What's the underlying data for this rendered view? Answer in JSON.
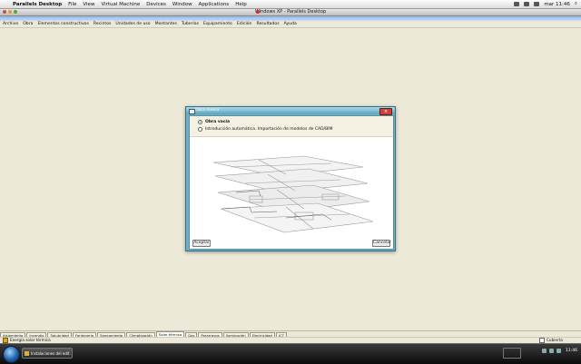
{
  "mac_menu": {
    "app_name": "Parallels Desktop",
    "items": [
      "File",
      "View",
      "Virtual Machine",
      "Devices",
      "Window",
      "Applications",
      "Help"
    ],
    "clock": "mar 11:46"
  },
  "vm_window": {
    "title": "Windows XP - Parallels Desktop"
  },
  "app_menu": {
    "items": [
      "Archivo",
      "Obra",
      "Elementos constructivos",
      "Recintos",
      "Unidades de uso",
      "Montantes",
      "Tuberías",
      "Equipamiento",
      "Edición",
      "Resultados",
      "Ayuda"
    ]
  },
  "dialog": {
    "title": "Obra nueva",
    "options": [
      {
        "label": "Obra vacía",
        "selected": true
      },
      {
        "label": "Introducción automática. Importación de modelos de CAD/BIM",
        "selected": false
      }
    ],
    "accept_label": "Aceptar",
    "cancel_label": "Cancelar"
  },
  "bottom_tabs": {
    "items": [
      "Aislamiento",
      "Incendio",
      "Salubridad",
      "Fontanería",
      "Saneamiento",
      "Climatización",
      "Solar térmica",
      "Gas",
      "Pararrayos",
      "Iluminación",
      "Electricidad",
      "ICT"
    ],
    "active_index": 6
  },
  "status_bar": {
    "left_text": "Energía solar térmica",
    "right_text": "Cubierta"
  },
  "taskbar": {
    "task_button": "Instalaciones del edif...",
    "clock": "11:46"
  },
  "colors": {
    "workspace": "#ece9d8",
    "dialog_frame": "#6fb0c6",
    "taskbar": "#111111"
  }
}
